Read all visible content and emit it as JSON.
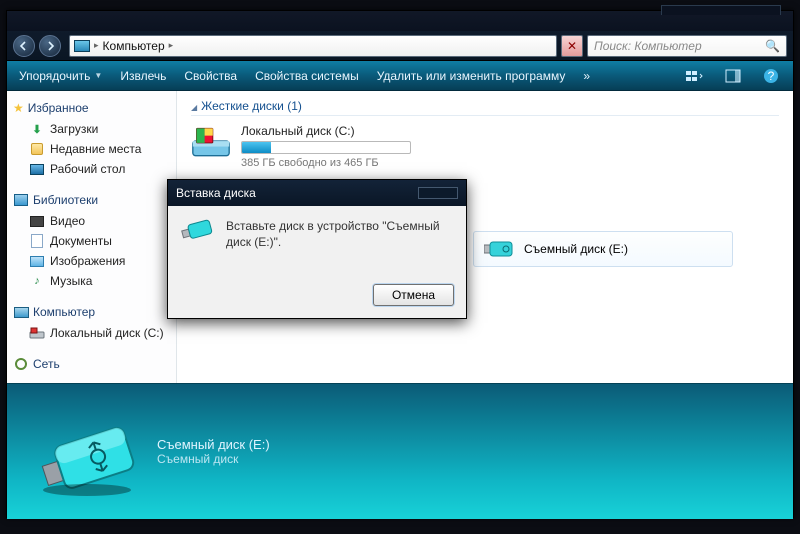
{
  "breadcrumb": {
    "root": "Компьютер"
  },
  "search": {
    "placeholder": "Поиск: Компьютер"
  },
  "toolbar": {
    "organize": "Упорядочить",
    "extract": "Извлечь",
    "properties": "Свойства",
    "sys_properties": "Свойства системы",
    "uninstall": "Удалить или изменить программу",
    "more": "»"
  },
  "sidebar": {
    "favorites": "Избранное",
    "downloads": "Загрузки",
    "recent": "Недавние места",
    "desktop": "Рабочий стол",
    "libraries": "Библиотеки",
    "video": "Видео",
    "documents": "Документы",
    "images": "Изображения",
    "music": "Музыка",
    "computer": "Компьютер",
    "local_c": "Локальный диск (C:)",
    "network": "Сеть"
  },
  "main": {
    "category": "Жесткие диски (1)",
    "local_disk": {
      "name": "Локальный диск (C:)",
      "free_text": "385 ГБ свободно из 465 ГБ",
      "fill_percent": 17
    },
    "removable": {
      "name": "Съемный диск (E:)"
    }
  },
  "details": {
    "line1": "Съемный диск (E:)",
    "line2": "Съемный диск"
  },
  "dialog": {
    "title": "Вставка диска",
    "message": "Вставьте диск в устройство \"Съемный диск (E:)\".",
    "cancel": "Отмена"
  }
}
